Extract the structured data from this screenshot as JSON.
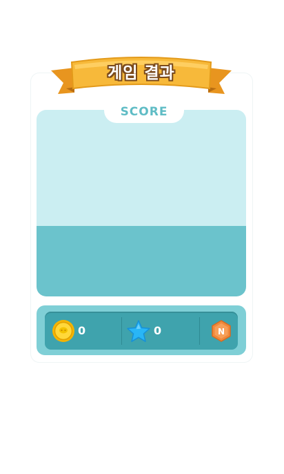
{
  "header": {
    "title": "게임 결과"
  },
  "score_panel": {
    "label": "SCORE"
  },
  "rewards": {
    "coin_count": "0",
    "star_count": "0",
    "badge_letter": "N"
  },
  "colors": {
    "panel_light": "#cbeef2",
    "panel_dark": "#6bc3cc",
    "bar_outer": "#7fcfd6",
    "bar_inner": "#3fa3ad",
    "ribbon": "#f6b63a",
    "badge": "#f08a3c"
  },
  "icons": {
    "coin": "coin-icon",
    "star": "star-icon",
    "badge": "hexagon-badge-icon"
  }
}
